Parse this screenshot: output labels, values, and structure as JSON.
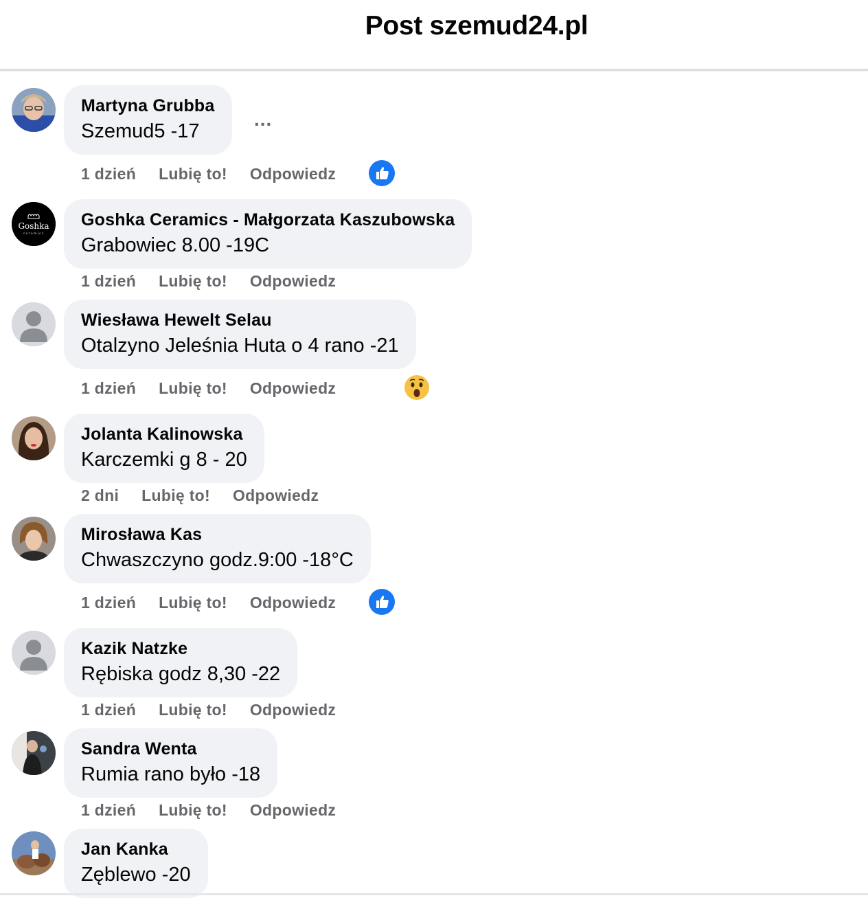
{
  "header": {
    "title": "Post szemud24.pl"
  },
  "comments": [
    {
      "author": "Martyna Grubba",
      "text": "Szemud5 -17",
      "time": "1 dzień",
      "like": "Lubię to!",
      "reply": "Odpowiedz",
      "reaction": "like-reaction-icon",
      "avatar": "photo"
    },
    {
      "author": "Goshka Ceramics - Małgorzata Kaszubowska",
      "text": "Grabowiec 8.00 -19C",
      "time": "1 dzień",
      "like": "Lubię to!",
      "reply": "Odpowiedz",
      "reaction": "",
      "avatar": "logo",
      "logo_text": "Goshka",
      "logo_sub": "ceramics"
    },
    {
      "author": "Wiesława Hewelt Selau",
      "text": "Otalzyno Jeleśnia Huta o 4 rano -21",
      "time": "1 dzień",
      "like": "Lubię to!",
      "reply": "Odpowiedz",
      "reaction": "wow-reaction-icon",
      "avatar": "default"
    },
    {
      "author": "Jolanta Kalinowska",
      "text": "Karczemki g 8 - 20",
      "time": "2 dni",
      "like": "Lubię to!",
      "reply": "Odpowiedz",
      "reaction": "",
      "avatar": "photo"
    },
    {
      "author": "Mirosława Kas",
      "text": "Chwaszczyno godz.9:00 -18°C",
      "time": "1 dzień",
      "like": "Lubię to!",
      "reply": "Odpowiedz",
      "reaction": "like-reaction-icon",
      "avatar": "photo"
    },
    {
      "author": "Kazik Natzke",
      "text": "Rębiska godz 8,30 -22",
      "time": "1 dzień",
      "like": "Lubię to!",
      "reply": "Odpowiedz",
      "reaction": "",
      "avatar": "default"
    },
    {
      "author": "Sandra Wenta",
      "text": "Rumia rano było -18",
      "time": "1 dzień",
      "like": "Lubię to!",
      "reply": "Odpowiedz",
      "reaction": "",
      "avatar": "photo"
    },
    {
      "author": "Jan Kanka",
      "text": "Zęblewo -20",
      "time": "",
      "like": "",
      "reply": "",
      "reaction": "",
      "avatar": "photo"
    }
  ],
  "more_options": "...",
  "colors": {
    "like_blue": "#1877f2",
    "bubble": "#f0f2f5",
    "meta_gray": "#65676b",
    "wow_yellow": "#f7c244"
  }
}
